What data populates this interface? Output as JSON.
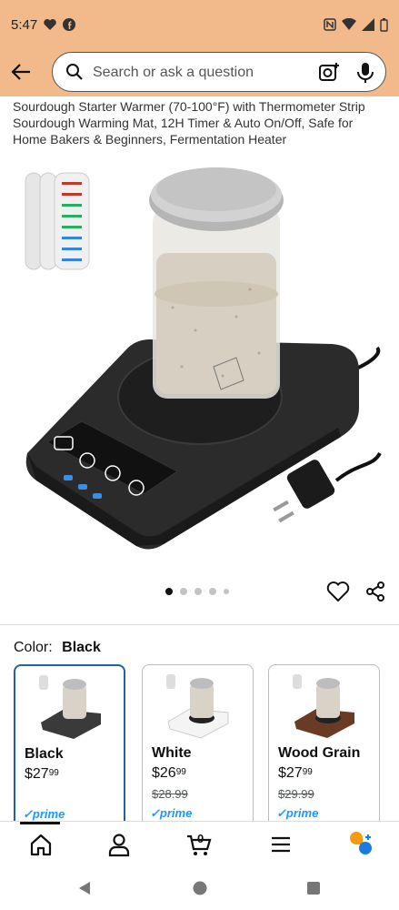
{
  "status": {
    "time": "5:47",
    "left_icons": [
      "heart-icon",
      "facebook-icon"
    ],
    "right_icons": [
      "nfc-icon",
      "wifi-icon",
      "signal-icon",
      "battery-icon"
    ]
  },
  "search": {
    "placeholder": "Search or ask a question"
  },
  "product": {
    "title": "Sourdough Starter Warmer (70-100°F) with Thermometer Strip Sourdough Warming Mat, 12H Timer & Auto On/Off, Safe for Home Bakers & Beginners, Fermentation Heater",
    "image_dots": 5,
    "active_dot": 0
  },
  "variant": {
    "label": "Color:",
    "selected": "Black",
    "options": [
      {
        "name": "Black",
        "price_whole": "$27",
        "price_fraction": "99",
        "was_price": "",
        "prime": "prime",
        "colors": {
          "base": "#3a3a3a"
        }
      },
      {
        "name": "White",
        "price_whole": "$26",
        "price_fraction": "99",
        "was_price": "$28.99",
        "prime": "prime",
        "colors": {
          "base": "#f2f2f2"
        }
      },
      {
        "name": "Wood Grain",
        "price_whole": "$27",
        "price_fraction": "99",
        "was_price": "$29.99",
        "prime": "prime",
        "colors": {
          "base": "#6b3a25"
        }
      }
    ]
  },
  "bottom_nav": {
    "items": [
      "home-icon",
      "account-icon",
      "cart-icon",
      "menu-icon",
      "rufus-icon"
    ],
    "cart_count": "0"
  },
  "colors": {
    "header_bg": "#f2b98a",
    "accent_blue": "#2162a1",
    "prime_blue": "#1a98ff"
  }
}
